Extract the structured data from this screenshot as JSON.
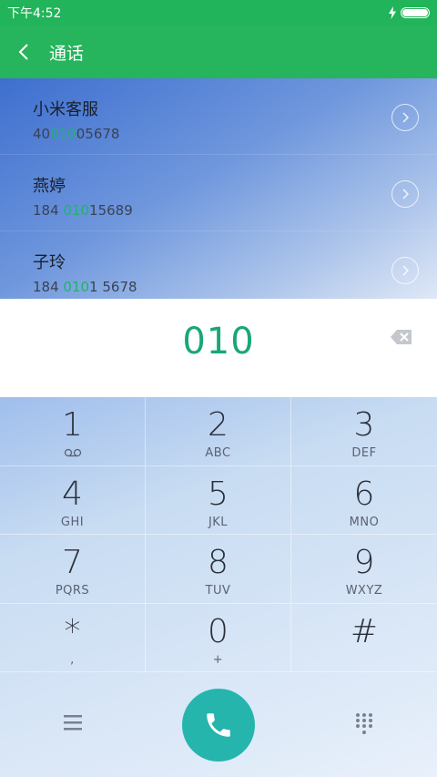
{
  "status": {
    "time": "下午4:52",
    "battery_level": 1.0
  },
  "header": {
    "title": "通话"
  },
  "results": [
    {
      "name": "小米客服",
      "number_prefix": "40",
      "number_match": "010",
      "number_suffix": "05678"
    },
    {
      "name": "燕婷",
      "number_prefix": "184 ",
      "number_match": "010",
      "number_suffix": "15689"
    },
    {
      "name": "子玲",
      "number_prefix": "184 ",
      "number_match": "010",
      "number_suffix": "1 5678"
    }
  ],
  "input": {
    "value": "010"
  },
  "keys": [
    {
      "digit": "1",
      "letters": "",
      "icon": "voicemail-icon"
    },
    {
      "digit": "2",
      "letters": "ABC"
    },
    {
      "digit": "3",
      "letters": "DEF"
    },
    {
      "digit": "4",
      "letters": "GHI"
    },
    {
      "digit": "5",
      "letters": "JKL"
    },
    {
      "digit": "6",
      "letters": "MNO"
    },
    {
      "digit": "7",
      "letters": "PQRS"
    },
    {
      "digit": "8",
      "letters": "TUV"
    },
    {
      "digit": "9",
      "letters": "WXYZ"
    },
    {
      "digit": "*",
      "letters": ","
    },
    {
      "digit": "0",
      "letters": "+"
    },
    {
      "digit": "#",
      "letters": ""
    }
  ],
  "colors": {
    "accent_green": "#26b45c",
    "match_green": "#1fb36a",
    "call_button": "#25b5ad"
  }
}
